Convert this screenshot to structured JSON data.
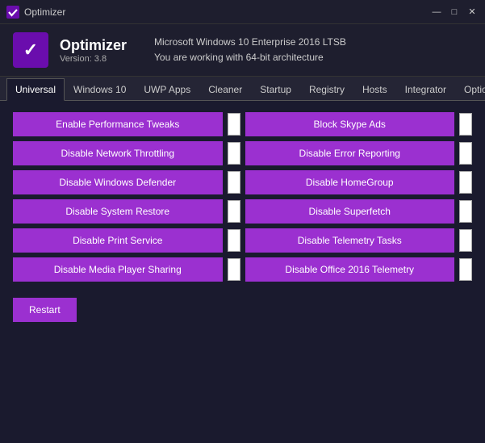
{
  "titlebar": {
    "title": "Optimizer",
    "minimize": "—",
    "maximize": "□",
    "close": "✕"
  },
  "header": {
    "app_name": "Optimizer",
    "version": "Version: 3.8",
    "desc_line1": "Microsoft Windows 10 Enterprise 2016 LTSB",
    "desc_line2": "You are working with 64-bit architecture"
  },
  "tabs": [
    {
      "id": "universal",
      "label": "Universal",
      "active": true
    },
    {
      "id": "windows10",
      "label": "Windows 10"
    },
    {
      "id": "uwp",
      "label": "UWP Apps"
    },
    {
      "id": "cleaner",
      "label": "Cleaner"
    },
    {
      "id": "startup",
      "label": "Startup"
    },
    {
      "id": "registry",
      "label": "Registry"
    },
    {
      "id": "hosts",
      "label": "Hosts"
    },
    {
      "id": "integrator",
      "label": "Integrator"
    },
    {
      "id": "options",
      "label": "Options"
    }
  ],
  "buttons": {
    "left": [
      "Enable Performance Tweaks",
      "Disable Network Throttling",
      "Disable Windows Defender",
      "Disable System Restore",
      "Disable Print Service",
      "Disable Media Player Sharing"
    ],
    "right": [
      "Block Skype Ads",
      "Disable Error Reporting",
      "Disable HomeGroup",
      "Disable Superfetch",
      "Disable Telemetry Tasks",
      "Disable Office 2016 Telemetry"
    ],
    "restart": "Restart"
  }
}
